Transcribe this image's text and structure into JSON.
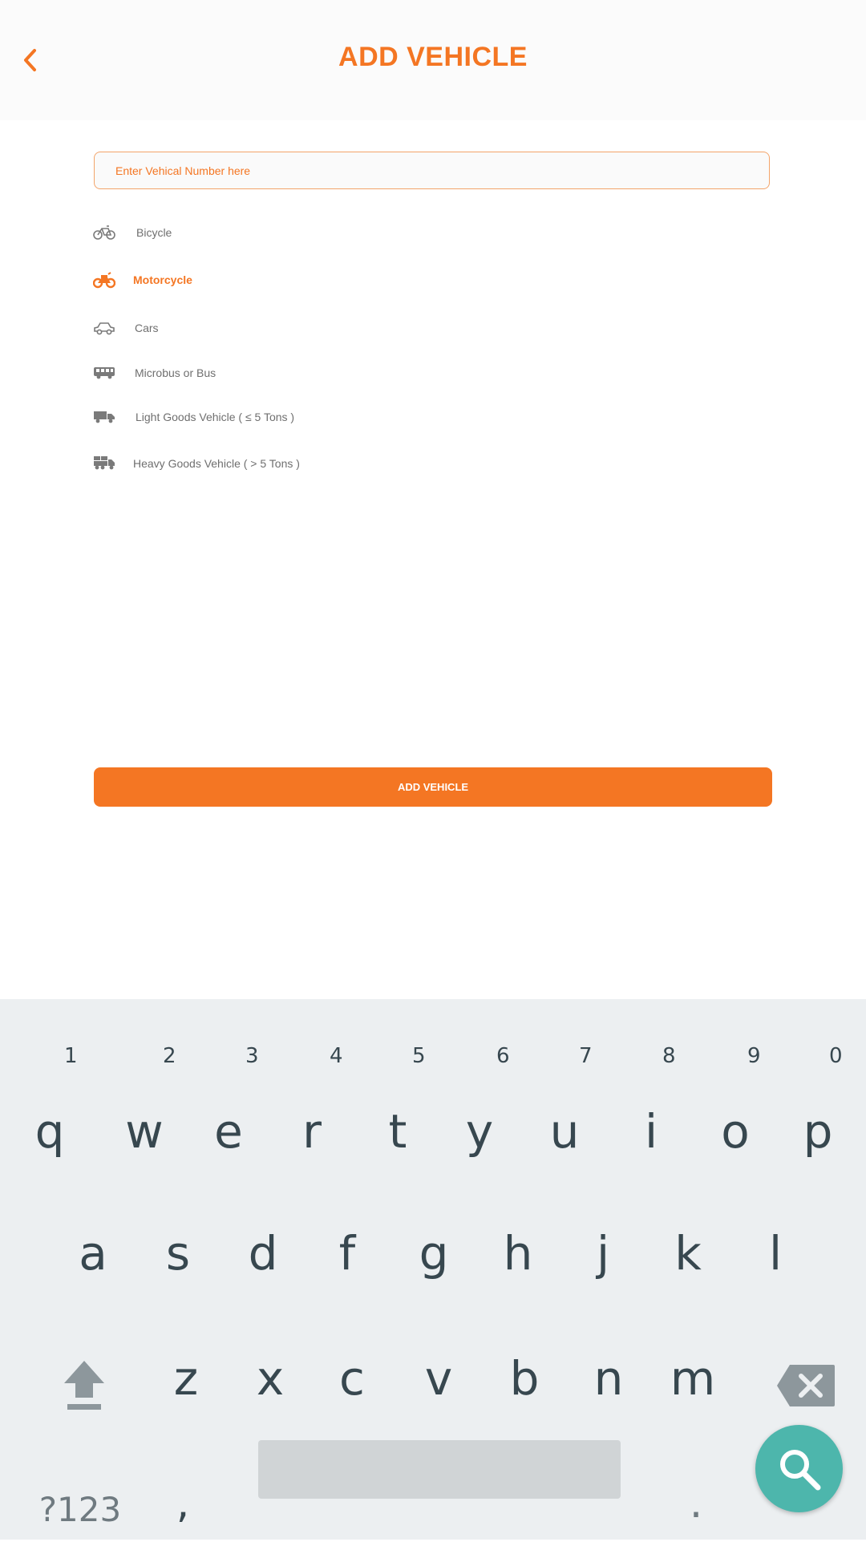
{
  "header": {
    "title": "ADD VEHICLE"
  },
  "form": {
    "vehicle_number_placeholder": "Enter Vehical Number here",
    "vehicle_number_value": ""
  },
  "vehicle_types": [
    {
      "label": "Bicycle",
      "icon": "bicycle-icon",
      "selected": false
    },
    {
      "label": "Motorcycle",
      "icon": "motorcycle-icon",
      "selected": true
    },
    {
      "label": "Cars",
      "icon": "car-icon",
      "selected": false
    },
    {
      "label": "Microbus or Bus",
      "icon": "bus-icon",
      "selected": false
    },
    {
      "label": "Light Goods Vehicle ( ≤ 5 Tons )",
      "icon": "light-truck-icon",
      "selected": false
    },
    {
      "label": "Heavy Goods Vehicle ( > 5 Tons )",
      "icon": "heavy-truck-icon",
      "selected": false
    }
  ],
  "submit_label": "ADD VEHICLE",
  "keyboard": {
    "row1": [
      "q",
      "w",
      "e",
      "r",
      "t",
      "y",
      "u",
      "i",
      "o",
      "p"
    ],
    "row1_hints": [
      "1",
      "2",
      "3",
      "4",
      "5",
      "6",
      "7",
      "8",
      "9",
      "0"
    ],
    "row2": [
      "a",
      "s",
      "d",
      "f",
      "g",
      "h",
      "j",
      "k",
      "l"
    ],
    "row3": [
      "z",
      "x",
      "c",
      "v",
      "b",
      "n",
      "m"
    ],
    "symbols_label": "?123",
    "comma": ",",
    "period": "."
  },
  "colors": {
    "accent": "#f47623",
    "keyboard_bg": "#eceff1",
    "key_text": "#37474f",
    "search_fab": "#4db6ac"
  }
}
